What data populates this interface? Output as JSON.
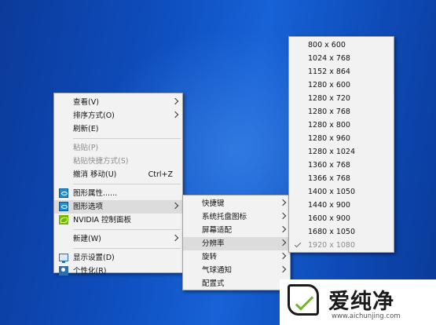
{
  "desktop_menu": {
    "items": [
      {
        "label": "查看(V)",
        "submenu": true
      },
      {
        "label": "排序方式(O)",
        "submenu": true
      },
      {
        "label": "刷新(E)"
      },
      {
        "label": "粘贴(P)",
        "disabled": true
      },
      {
        "label": "粘贴快捷方式(S)",
        "disabled": true
      },
      {
        "label": "撤消 移动(U)",
        "shortcut": "Ctrl+Z"
      },
      {
        "label": "图形属性......",
        "icon": "intel-graphics-icon"
      },
      {
        "label": "图形选项",
        "icon": "intel-graphics-icon",
        "submenu": true,
        "highlighted": true
      },
      {
        "label": "NVIDIA 控制面板",
        "icon": "nvidia-icon"
      },
      {
        "label": "新建(W)",
        "submenu": true
      },
      {
        "label": "显示设置(D)",
        "icon": "display-icon"
      },
      {
        "label": "个性化(R)",
        "icon": "personalize-icon"
      }
    ]
  },
  "graphics_options_menu": {
    "items": [
      {
        "label": "快捷键",
        "submenu": true
      },
      {
        "label": "系统托盘图标",
        "submenu": true
      },
      {
        "label": "屏幕适配",
        "submenu": true
      },
      {
        "label": "分辨率",
        "submenu": true,
        "highlighted": true
      },
      {
        "label": "旋转",
        "submenu": true
      },
      {
        "label": "气球通知",
        "submenu": true
      },
      {
        "label": "配置式"
      }
    ]
  },
  "resolution_menu": {
    "items": [
      "800 x 600",
      "1024 x 768",
      "1152 x 864",
      "1280 x 600",
      "1280 x 720",
      "1280 x 768",
      "1280 x 800",
      "1280 x 960",
      "1280 x 1024",
      "1360 x 768",
      "1366 x 768",
      "1400 x 1050",
      "1440 x 900",
      "1600 x 900",
      "1680 x 1050",
      "1920 x 1080"
    ],
    "selected": "1920 x 1080"
  },
  "watermark": {
    "title": "爱纯净",
    "url": "www.aichunjing.com"
  },
  "colors": {
    "desktop_blue": "#0f4fc0",
    "menu_background": "#f2f2f2",
    "highlight": "#dcdcdc"
  }
}
